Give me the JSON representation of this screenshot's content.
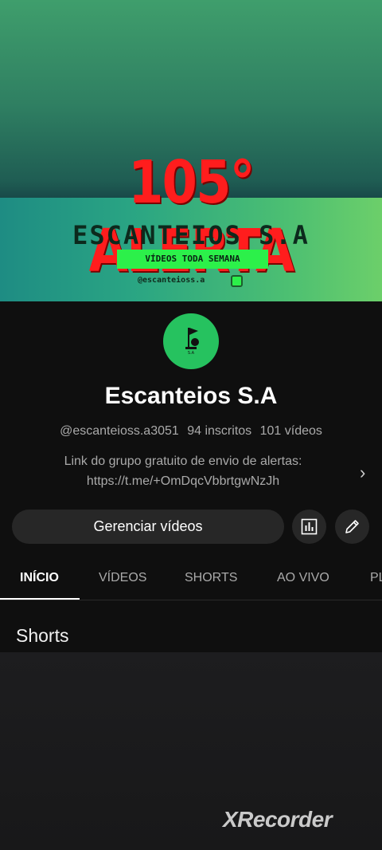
{
  "banner": {
    "headline": "105° ALERTA",
    "brand": "ESCANTEIOS S.A",
    "tagline": "VÍDEOS TODA SEMANA",
    "handle": "@escanteioss.a"
  },
  "channel": {
    "name": "Escanteios S.A",
    "handle": "@escanteioss.a3051",
    "subscribers": "94 inscritos",
    "videos": "101 vídeos",
    "description_line1": "Link do grupo gratuito de envio de alertas:",
    "description_line2": "https://t.me/+OmDqcVbbrtgwNzJh"
  },
  "actions": {
    "manage_label": "Gerenciar vídeos",
    "analytics_icon": "bar-chart-icon",
    "edit_icon": "pencil-icon"
  },
  "tabs": [
    {
      "label": "INÍCIO",
      "active": true
    },
    {
      "label": "VÍDEOS",
      "active": false
    },
    {
      "label": "SHORTS",
      "active": false
    },
    {
      "label": "AO VIVO",
      "active": false
    },
    {
      "label": "PL",
      "active": false
    }
  ],
  "section": {
    "title": "Shorts"
  },
  "watermark": "XRecorder",
  "colors": {
    "alert_red": "#ff1d1d",
    "tagline_green": "#2cf04a",
    "avatar_green": "#26c25f"
  }
}
